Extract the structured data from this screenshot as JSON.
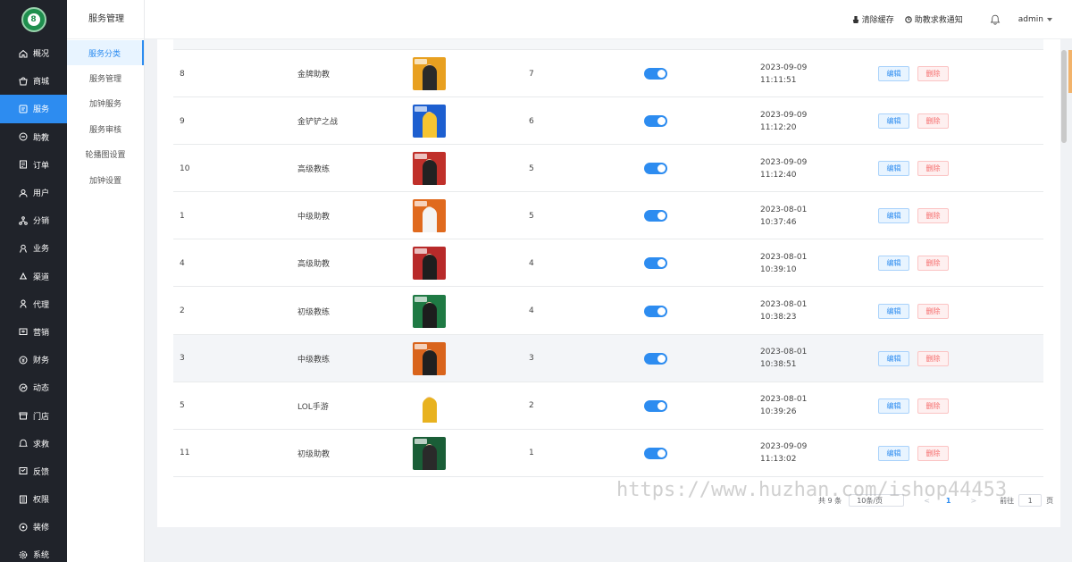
{
  "sidebar": {
    "logo_text": "8",
    "items": [
      {
        "label": "概况",
        "icon": "home-icon"
      },
      {
        "label": "商城",
        "icon": "shop-icon"
      },
      {
        "label": "服务",
        "icon": "service-icon"
      },
      {
        "label": "助教",
        "icon": "assistant-icon"
      },
      {
        "label": "订单",
        "icon": "order-icon"
      },
      {
        "label": "用户",
        "icon": "user-icon"
      },
      {
        "label": "分销",
        "icon": "distribution-icon"
      },
      {
        "label": "业务",
        "icon": "business-icon"
      },
      {
        "label": "渠道",
        "icon": "channel-icon"
      },
      {
        "label": "代理",
        "icon": "agent-icon"
      },
      {
        "label": "营销",
        "icon": "marketing-icon"
      },
      {
        "label": "财务",
        "icon": "finance-icon"
      },
      {
        "label": "动态",
        "icon": "dynamic-icon"
      },
      {
        "label": "门店",
        "icon": "store-icon"
      },
      {
        "label": "求救",
        "icon": "sos-icon"
      },
      {
        "label": "反馈",
        "icon": "feedback-icon"
      },
      {
        "label": "权限",
        "icon": "permission-icon"
      },
      {
        "label": "装修",
        "icon": "decoration-icon"
      },
      {
        "label": "系统",
        "icon": "settings-icon"
      }
    ],
    "active_index": 2
  },
  "submenu": {
    "title": "服务管理",
    "items": [
      "服务分类",
      "服务管理",
      "加钟服务",
      "服务审核",
      "轮播图设置",
      "加钟设置"
    ],
    "active_index": 0
  },
  "header": {
    "clear_cache": "清除缓存",
    "sos_notice": "助教求救通知",
    "user": "admin"
  },
  "table": {
    "rows": [
      {
        "id": "8",
        "name": "金牌助教",
        "sort": "7",
        "date": "2023-09-09",
        "time": "11:11:51",
        "thumb_bg": "#e8a020",
        "person": "#2a2a2a"
      },
      {
        "id": "9",
        "name": "金铲铲之战",
        "sort": "6",
        "date": "2023-09-09",
        "time": "11:12:20",
        "thumb_bg": "#1d5fd0",
        "person": "#f6c431"
      },
      {
        "id": "10",
        "name": "高级教练",
        "sort": "5",
        "date": "2023-09-09",
        "time": "11:12:40",
        "thumb_bg": "#c0302a",
        "person": "#222222"
      },
      {
        "id": "1",
        "name": "中级助教",
        "sort": "5",
        "date": "2023-08-01",
        "time": "10:37:46",
        "thumb_bg": "#e06a1e",
        "person": "#f4f4f4"
      },
      {
        "id": "4",
        "name": "高级助教",
        "sort": "4",
        "date": "2023-08-01",
        "time": "10:39:10",
        "thumb_bg": "#b82a2a",
        "person": "#1e1e1e"
      },
      {
        "id": "2",
        "name": "初级教练",
        "sort": "4",
        "date": "2023-08-01",
        "time": "10:38:23",
        "thumb_bg": "#1f7a44",
        "person": "#1d1d1d"
      },
      {
        "id": "3",
        "name": "中级教练",
        "sort": "3",
        "date": "2023-08-01",
        "time": "10:38:51",
        "thumb_bg": "#d9641c",
        "person": "#202020"
      },
      {
        "id": "5",
        "name": "LOL手游",
        "sort": "2",
        "date": "2023-08-01",
        "time": "10:39:26",
        "thumb_bg": "#ffffff",
        "person": "#e8b21f"
      },
      {
        "id": "11",
        "name": "初级助教",
        "sort": "1",
        "date": "2023-09-09",
        "time": "11:13:02",
        "thumb_bg": "#1a5e37",
        "person": "#2a2a2a"
      }
    ],
    "edit_label": "编辑",
    "delete_label": "删除",
    "highlight_index": 6
  },
  "pagination": {
    "total": "共 9 条",
    "page_size": "10条/页",
    "prev": "<",
    "current": "1",
    "next": ">",
    "goto_label": "前往",
    "goto_value": "1",
    "page_suffix": "页"
  },
  "watermark": "https://www.huzhan.com/ishop44453",
  "colors": {
    "sidebar_bg": "#20232a",
    "accent": "#2d8cf0",
    "danger": "#f56c6c"
  }
}
